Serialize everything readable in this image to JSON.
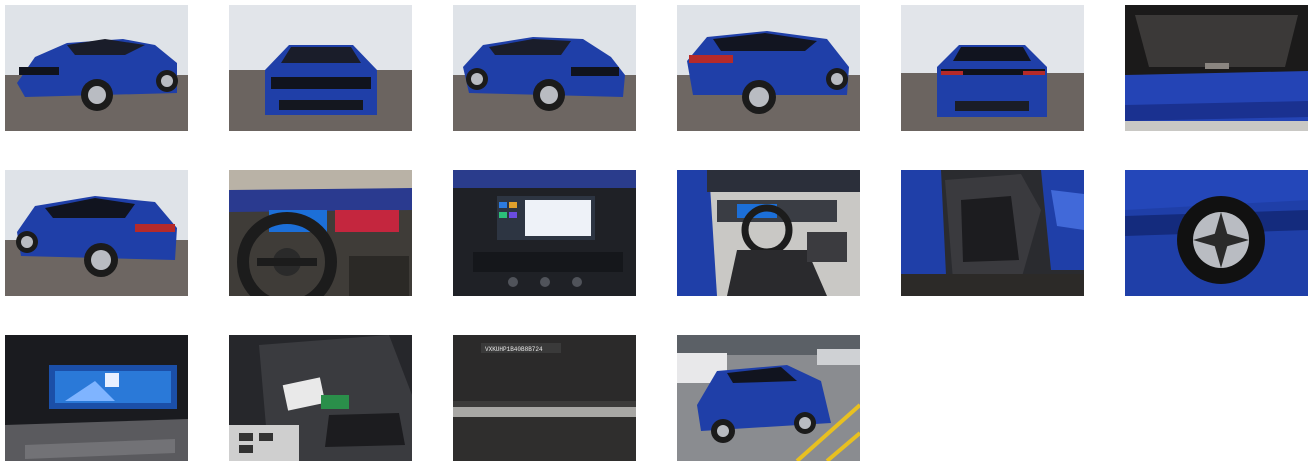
{
  "gallery": {
    "accent_color": "#1f3fa8",
    "photos": [
      {
        "icon": "car-front-left-photo"
      },
      {
        "icon": "car-front-photo"
      },
      {
        "icon": "car-front-right-photo"
      },
      {
        "icon": "car-rear-right-photo"
      },
      {
        "icon": "car-rear-photo"
      },
      {
        "icon": "trunk-photo"
      },
      {
        "icon": "car-rear-left-photo"
      },
      {
        "icon": "steering-wheel-photo"
      },
      {
        "icon": "infotainment-photo"
      },
      {
        "icon": "interior-driver-photo"
      },
      {
        "icon": "rear-seat-photo"
      },
      {
        "icon": "wheel-photo"
      },
      {
        "icon": "instrument-cluster-photo"
      },
      {
        "icon": "center-console-photo"
      },
      {
        "icon": "vin-plate-photo"
      },
      {
        "icon": "car-parking-photo"
      }
    ],
    "vin_text": "VXKUHP1B40B8B724"
  }
}
